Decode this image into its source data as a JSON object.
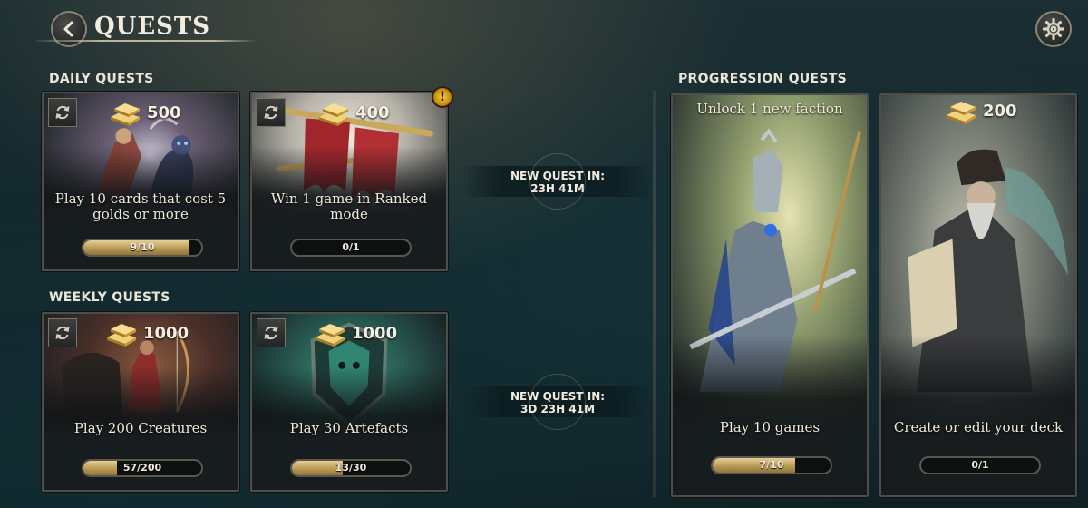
{
  "header": {
    "title": "QUESTS",
    "back_icon": "chevron-left-icon",
    "settings_icon": "gear-icon"
  },
  "sections": {
    "daily": "DAILY QUESTS",
    "weekly": "WEEKLY QUESTS",
    "progression": "PROGRESSION QUESTS"
  },
  "daily": [
    {
      "reward": "500",
      "text": "Play 10 cards that cost 5 golds or more",
      "progress": "9/10",
      "fraction": 0.9,
      "art": "mage-art"
    },
    {
      "reward": "400",
      "text": "Win 1 game in Ranked mode",
      "progress": "0/1",
      "fraction": 0,
      "art": "trumpet-banner-art",
      "alert": "!"
    }
  ],
  "weekly": [
    {
      "reward": "1000",
      "text": "Play 200 Creatures",
      "progress": "57/200",
      "fraction": 0.285,
      "art": "horse-archer-art"
    },
    {
      "reward": "1000",
      "text": "Play 30 Artefacts",
      "progress": "13/30",
      "fraction": 0.433,
      "art": "shield-artefact-art"
    }
  ],
  "timers": {
    "daily": {
      "label": "NEW QUEST IN:",
      "time": "23H 41M"
    },
    "weekly": {
      "label": "NEW QUEST IN:",
      "time": "3D 23H 41M"
    }
  },
  "progression": [
    {
      "title": "Unlock 1 new faction",
      "text": "Play 10 games",
      "progress": "7/10",
      "fraction": 0.7,
      "art": "knight-art"
    },
    {
      "reward": "200",
      "text": "Create or edit your deck",
      "progress": "0/1",
      "fraction": 0,
      "art": "wizard-art"
    }
  ],
  "colors": {
    "gold": "#e0c27a",
    "accent": "#f4cf3a"
  }
}
